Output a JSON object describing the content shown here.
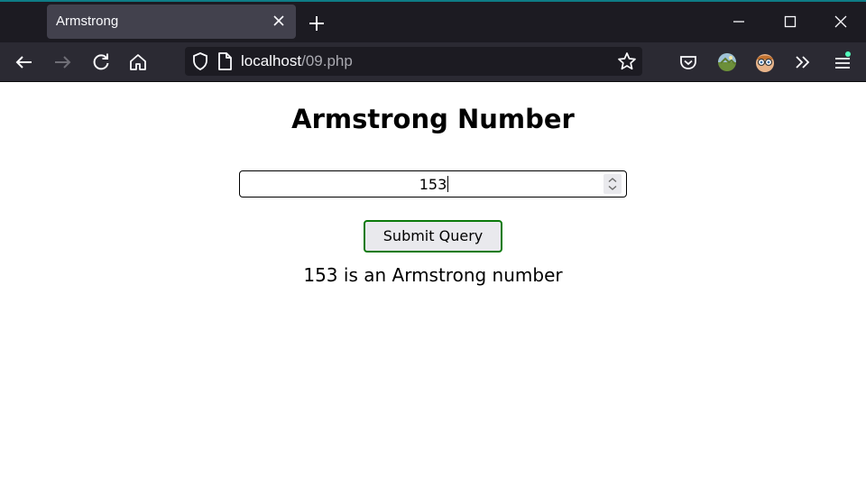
{
  "browser": {
    "tab_title": "Armstrong",
    "url_host": "localhost",
    "url_path": "/09.php"
  },
  "page": {
    "heading": "Armstrong Number",
    "number_value": "153",
    "submit_label": "Submit Query",
    "result_text": "153 is an Armstrong number"
  },
  "colors": {
    "titlebar": "#1c1b22",
    "toolbar": "#2b2a33",
    "submit_border": "#0a7a0a"
  }
}
